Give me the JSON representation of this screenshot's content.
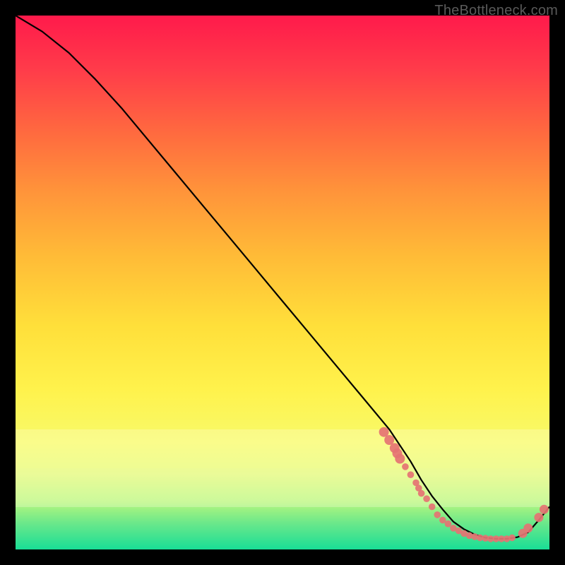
{
  "watermark": "TheBottleneck.com",
  "chart_data": {
    "type": "line",
    "title": "",
    "xlabel": "",
    "ylabel": "",
    "xlim": [
      0,
      100
    ],
    "ylim": [
      0,
      100
    ],
    "series": [
      {
        "name": "curve",
        "x": [
          0,
          5,
          10,
          15,
          20,
          25,
          30,
          35,
          40,
          45,
          50,
          55,
          60,
          65,
          70,
          72,
          74,
          76,
          78,
          80,
          82,
          84,
          86,
          88,
          90,
          92,
          94,
          96,
          98,
          100
        ],
        "y": [
          100,
          97,
          93,
          88,
          82.5,
          76.5,
          70.5,
          64.5,
          58.5,
          52.5,
          46.5,
          40.5,
          34.5,
          28.5,
          22.5,
          19.5,
          16.5,
          13,
          10,
          7.5,
          5.2,
          3.8,
          2.8,
          2.2,
          2,
          2,
          2.3,
          3.2,
          5.5,
          8
        ]
      }
    ],
    "scatter": [
      {
        "name": "dots-cluster",
        "x": [
          69,
          70,
          71,
          71.5,
          72,
          73,
          74,
          75,
          75.5,
          76,
          77,
          78,
          79,
          80,
          81,
          82,
          83,
          84,
          85,
          86,
          87,
          88,
          89,
          90,
          91,
          92,
          93,
          95,
          96,
          98,
          99
        ],
        "y": [
          22,
          20.5,
          19,
          18,
          17,
          15.5,
          14,
          12.5,
          11.5,
          10.5,
          9.5,
          8,
          6.5,
          5.5,
          4.8,
          4,
          3.5,
          3,
          2.6,
          2.4,
          2.2,
          2.1,
          2,
          2,
          2,
          2,
          2.2,
          3,
          4,
          6,
          7.5
        ]
      }
    ],
    "colors": {
      "curve_stroke": "#000000",
      "dot_fill": "#e57373",
      "gradient_stops": [
        "#ff1a4b",
        "#ff943a",
        "#ffdf3a",
        "#e2fa7a",
        "#19de96"
      ]
    }
  }
}
